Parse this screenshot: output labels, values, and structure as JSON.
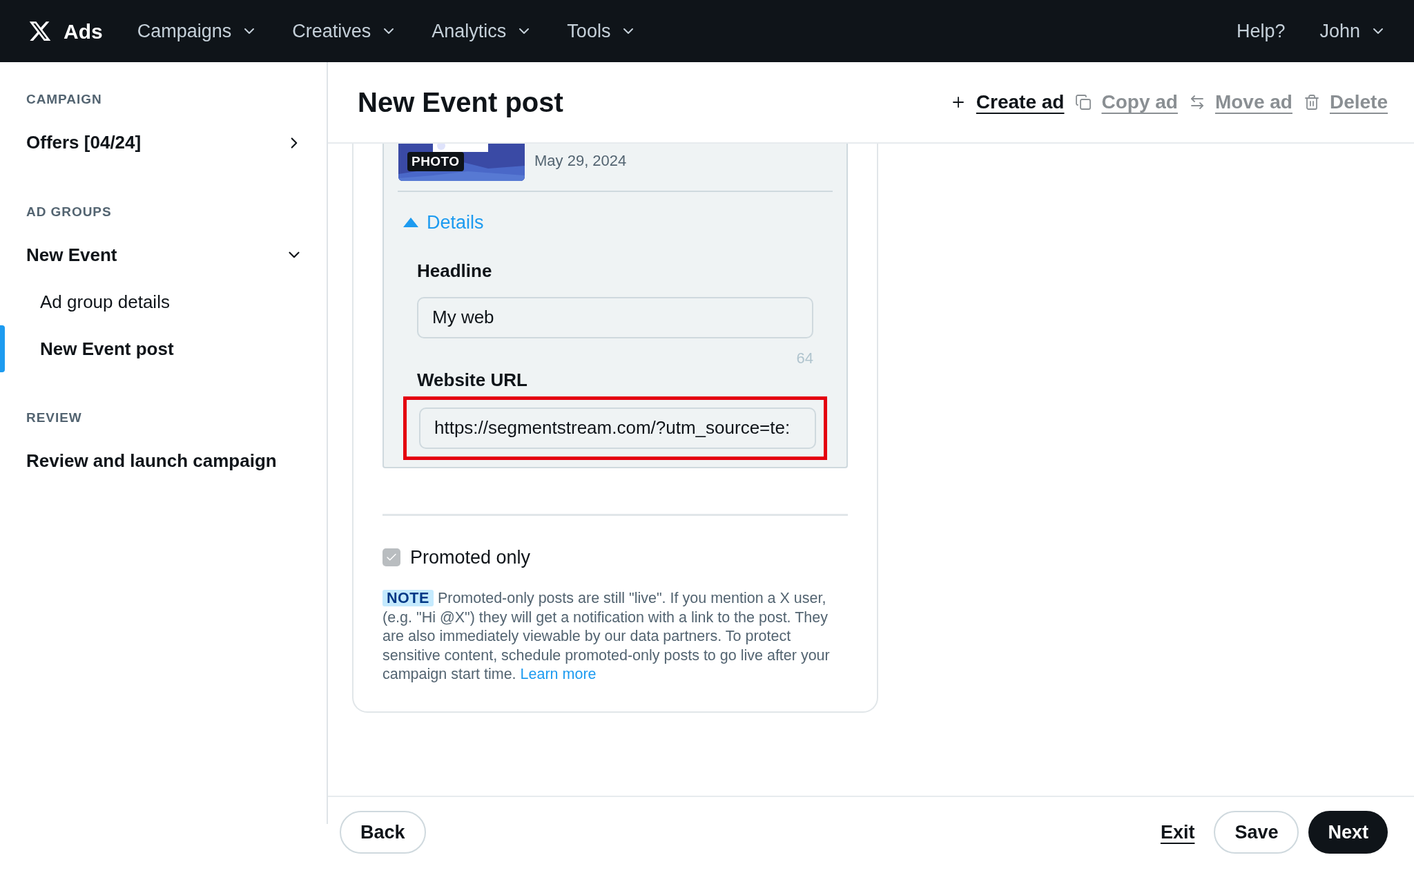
{
  "nav": {
    "brand": "Ads",
    "menus": [
      {
        "label": "Campaigns"
      },
      {
        "label": "Creatives"
      },
      {
        "label": "Analytics"
      },
      {
        "label": "Tools"
      }
    ],
    "help": "Help?",
    "user": "John"
  },
  "sidebar": {
    "sections": [
      {
        "heading": "CAMPAIGN",
        "items": [
          {
            "label": "Offers [04/24]",
            "kind": "link"
          }
        ]
      },
      {
        "heading": "AD GROUPS",
        "items": [
          {
            "label": "New Event",
            "kind": "group",
            "expanded": true,
            "children": [
              {
                "label": "Ad group details",
                "selected": false
              },
              {
                "label": "New Event post",
                "selected": true
              }
            ]
          }
        ]
      },
      {
        "heading": "REVIEW",
        "items": [
          {
            "label": "Review and launch campaign",
            "kind": "plain"
          }
        ]
      }
    ]
  },
  "page": {
    "title": "New Event post",
    "actions": [
      {
        "label": "Create ad",
        "disabled": false
      },
      {
        "label": "Copy ad",
        "disabled": true
      },
      {
        "label": "Move ad",
        "disabled": true
      },
      {
        "label": "Delete",
        "disabled": true
      }
    ]
  },
  "post": {
    "media_badge": "PHOTO",
    "date": "May 29, 2024",
    "details": {
      "label": "Details",
      "expanded": true
    },
    "headline": {
      "label": "Headline",
      "value": "My web",
      "counter": "64"
    },
    "website_url": {
      "label": "Website URL",
      "value": "https://segmentstream.com/?utm_source=te:",
      "highlighted": true
    }
  },
  "promoted_only": {
    "label": "Promoted only",
    "checked": true
  },
  "note": {
    "badge": "NOTE",
    "text": "Promoted-only posts are still \"live\". If you mention a X user, (e.g. \"Hi @X\") they will get a notification with a link to the post. They are also immediately viewable by our data partners. To protect sensitive content, schedule promoted-only posts to go live after your campaign start time.",
    "link": "Learn more"
  },
  "footer": {
    "back": "Back",
    "exit": "Exit",
    "save": "Save",
    "next": "Next"
  }
}
